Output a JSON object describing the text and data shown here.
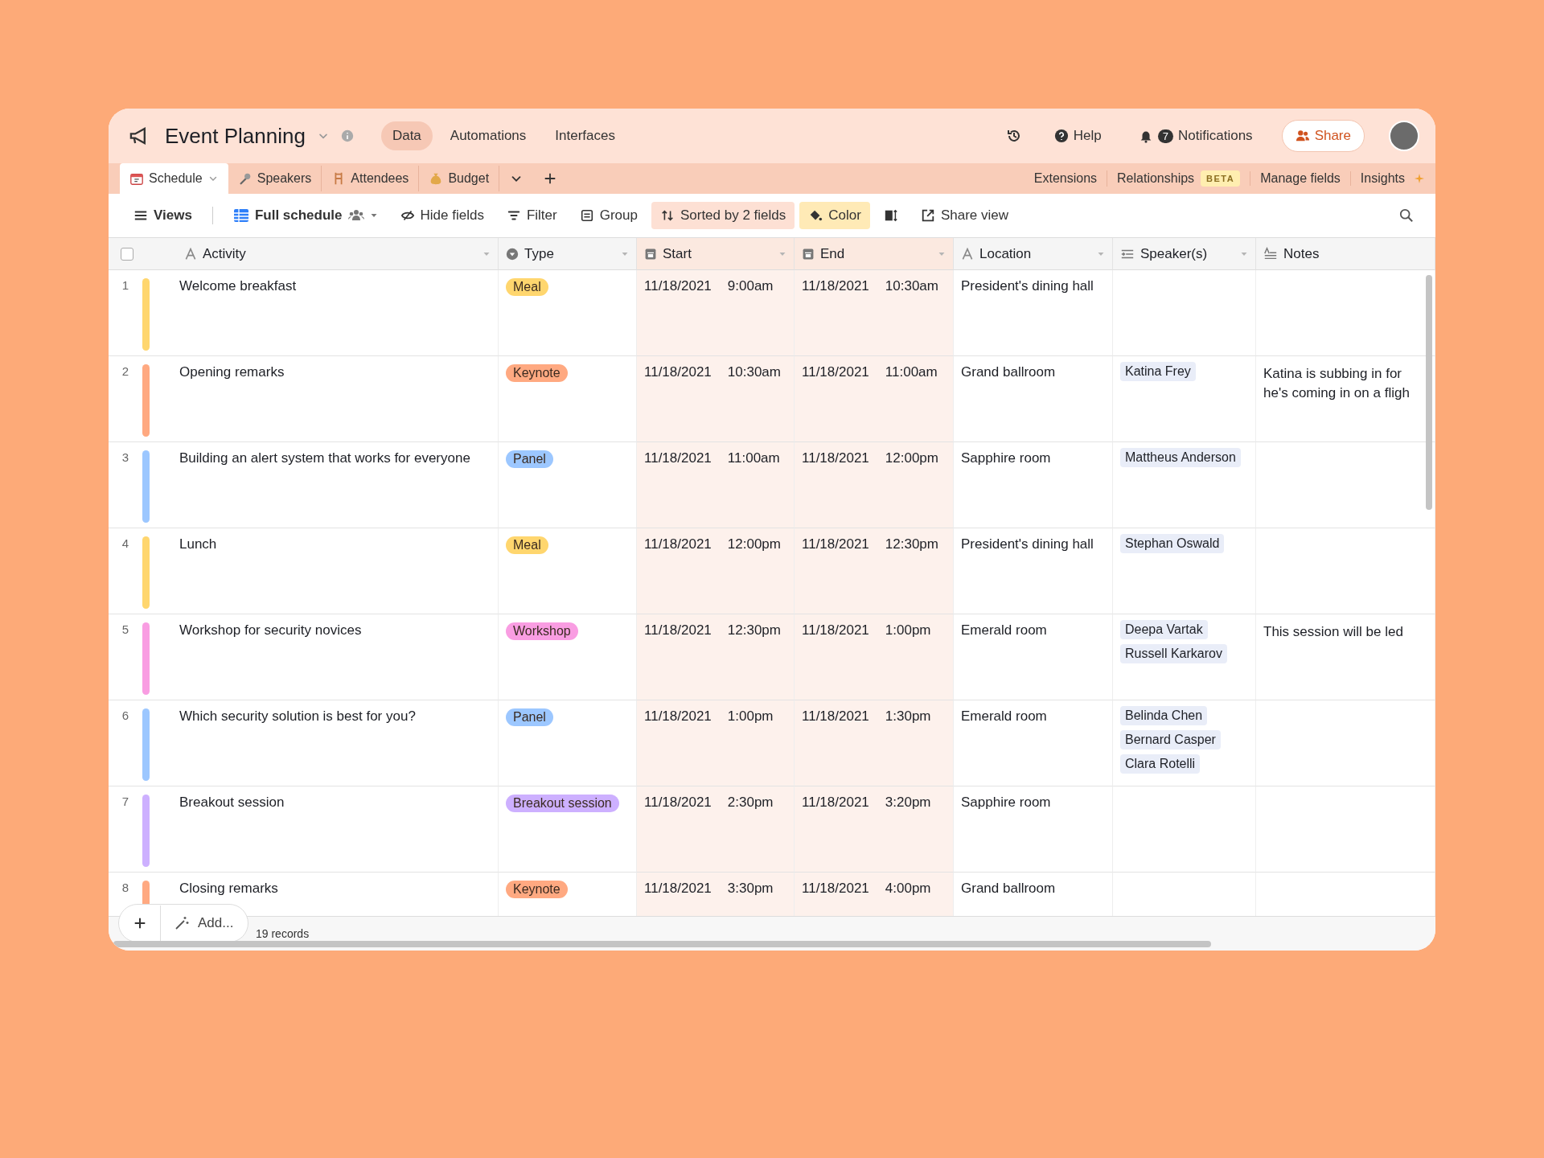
{
  "base": {
    "title": "Event Planning",
    "nav": [
      {
        "label": "Data",
        "selected": true
      },
      {
        "label": "Automations",
        "selected": false
      },
      {
        "label": "Interfaces",
        "selected": false
      }
    ]
  },
  "top_actions": {
    "help": "Help",
    "notification_count": "7",
    "notifications": "Notifications",
    "share": "Share"
  },
  "tables": [
    {
      "label": "Schedule",
      "kind": "calendar",
      "selected": true
    },
    {
      "label": "Speakers",
      "kind": "microphone",
      "selected": false
    },
    {
      "label": "Attendees",
      "kind": "chair",
      "selected": false
    },
    {
      "label": "Budget",
      "kind": "money",
      "selected": false
    }
  ],
  "table_links": [
    {
      "label": "Extensions"
    },
    {
      "label": "Relationships",
      "badge": "BETA"
    },
    {
      "label": "Manage fields"
    },
    {
      "label": "Insights"
    }
  ],
  "toolbar": {
    "views": "Views",
    "view_name": "Full schedule",
    "share_view": "Share view",
    "buttons": [
      {
        "label": "Hide fields",
        "kind": "hide",
        "active": false
      },
      {
        "label": "Filter",
        "kind": "filter",
        "active": false
      },
      {
        "label": "Group",
        "kind": "group",
        "active": false
      },
      {
        "label": "Sorted by 2 fields",
        "kind": "sort",
        "active": true
      },
      {
        "label": "Color",
        "kind": "color",
        "active": true
      }
    ]
  },
  "table": {
    "select_all": {
      "checked": false
    },
    "columns": [
      {
        "name": "Activity",
        "kind": "text",
        "sorted": false
      },
      {
        "name": "Type",
        "kind": "select",
        "sorted": false
      },
      {
        "name": "Start",
        "kind": "date",
        "sorted": true
      },
      {
        "name": "End",
        "kind": "date",
        "sorted": true
      },
      {
        "name": "Location",
        "kind": "text",
        "sorted": false
      },
      {
        "name": "Speaker(s)",
        "kind": "link",
        "sorted": false
      },
      {
        "name": "Notes",
        "kind": "longtext",
        "sorted": false
      }
    ],
    "rows": [
      {
        "number": "1",
        "activity": "Welcome breakfast",
        "type": "Meal",
        "color": "#ffd66e",
        "start_date": "11/18/2021",
        "start_time": "9:00am",
        "end_date": "11/18/2021",
        "end_time": "10:30am",
        "location": "President's dining hall",
        "speakers": [],
        "notes": []
      },
      {
        "number": "2",
        "activity": "Opening remarks",
        "type": "Keynote",
        "color": "#ffa981",
        "start_date": "11/18/2021",
        "start_time": "10:30am",
        "end_date": "11/18/2021",
        "end_time": "11:00am",
        "location": "Grand ballroom",
        "speakers": [
          "Katina Frey"
        ],
        "notes": [
          "Katina is subbing in for",
          "he's coming in on a fligh"
        ]
      },
      {
        "number": "3",
        "activity": "Building an alert system that works for everyone",
        "type": "Panel",
        "color": "#9cc7ff",
        "start_date": "11/18/2021",
        "start_time": "11:00am",
        "end_date": "11/18/2021",
        "end_time": "12:00pm",
        "location": "Sapphire room",
        "speakers": [
          "Mattheus Anderson"
        ],
        "notes": []
      },
      {
        "number": "4",
        "activity": "Lunch",
        "type": "Meal",
        "color": "#ffd66e",
        "start_date": "11/18/2021",
        "start_time": "12:00pm",
        "end_date": "11/18/2021",
        "end_time": "12:30pm",
        "location": "President's dining hall",
        "speakers": [
          "Stephan Oswald"
        ],
        "notes": []
      },
      {
        "number": "5",
        "activity": "Workshop for security novices",
        "type": "Workshop",
        "color": "#f99de2",
        "start_date": "11/18/2021",
        "start_time": "12:30pm",
        "end_date": "11/18/2021",
        "end_time": "1:00pm",
        "location": "Emerald room",
        "speakers": [
          "Deepa Vartak",
          "Russell Karkarov"
        ],
        "notes": [
          "This session will be led"
        ]
      },
      {
        "number": "6",
        "activity": "Which security solution is best for you?",
        "type": "Panel",
        "color": "#9cc7ff",
        "start_date": "11/18/2021",
        "start_time": "1:00pm",
        "end_date": "11/18/2021",
        "end_time": "1:30pm",
        "location": "Emerald room",
        "speakers": [
          "Belinda Chen",
          "Bernard Casper",
          "Clara Rotelli"
        ],
        "notes": []
      },
      {
        "number": "7",
        "activity": "Breakout session",
        "type": "Breakout session",
        "color": "#cdb0ff",
        "start_date": "11/18/2021",
        "start_time": "2:30pm",
        "end_date": "11/18/2021",
        "end_time": "3:20pm",
        "location": "Sapphire room",
        "speakers": [],
        "notes": []
      },
      {
        "number": "8",
        "activity": "Closing remarks",
        "type": "Keynote",
        "color": "#ffa981",
        "start_date": "11/18/2021",
        "start_time": "3:30pm",
        "end_date": "11/18/2021",
        "end_time": "4:00pm",
        "location": "Grand ballroom",
        "speakers": [],
        "notes": []
      }
    ]
  },
  "footer": {
    "add": "Add...",
    "records": "19 records"
  }
}
